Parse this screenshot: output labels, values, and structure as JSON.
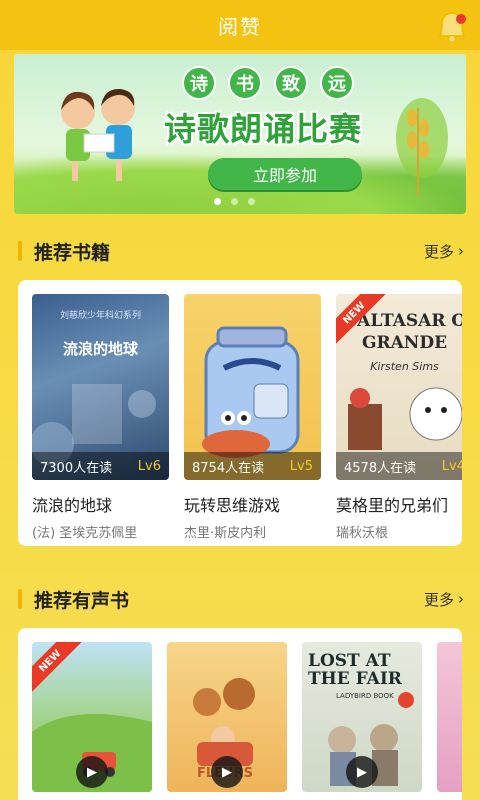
{
  "header": {
    "title": "阅赞",
    "bell_icon": "bell-icon"
  },
  "banner": {
    "tags": [
      "诗",
      "书",
      "致",
      "远"
    ],
    "title": "诗歌朗诵比赛",
    "cta": "立即参加",
    "dots": 3,
    "active_dot": 0
  },
  "books_section": {
    "title": "推荐书籍",
    "more": "更多",
    "books": [
      {
        "cover_title": "流浪的地球",
        "cover_series": "刘慈欣少年科幻系列",
        "readers": "7300人在读",
        "level": "Lv6",
        "name": "流浪的地球",
        "author": "(法) 圣埃克苏佩里",
        "is_new": false
      },
      {
        "cover_title": "",
        "cover_series": "",
        "readers": "8754人在读",
        "level": "Lv5",
        "name": "玩转思维游戏",
        "author": "杰里·斯皮内利",
        "is_new": false
      },
      {
        "cover_title": "BALTASAR O GRANDE",
        "cover_series": "Kirsten Sims",
        "readers": "4578人在读",
        "level": "Lv4",
        "name": "莫格里的兄弟们",
        "author": "瑞秋沃根",
        "is_new": true
      }
    ]
  },
  "audio_section": {
    "title": "推荐有声书",
    "more": "更多",
    "covers": [
      {
        "label": "",
        "is_new": true
      },
      {
        "label": "FLEURS",
        "is_new": false
      },
      {
        "label": "LOST AT THE FAIR",
        "publisher": "LADYBIRD BOOK",
        "is_new": false
      }
    ]
  },
  "ribbon_text": "NEW",
  "colors": {
    "header": "#f4c312",
    "accent": "#f2b400",
    "green": "#43b649",
    "level": "#f7c826"
  }
}
